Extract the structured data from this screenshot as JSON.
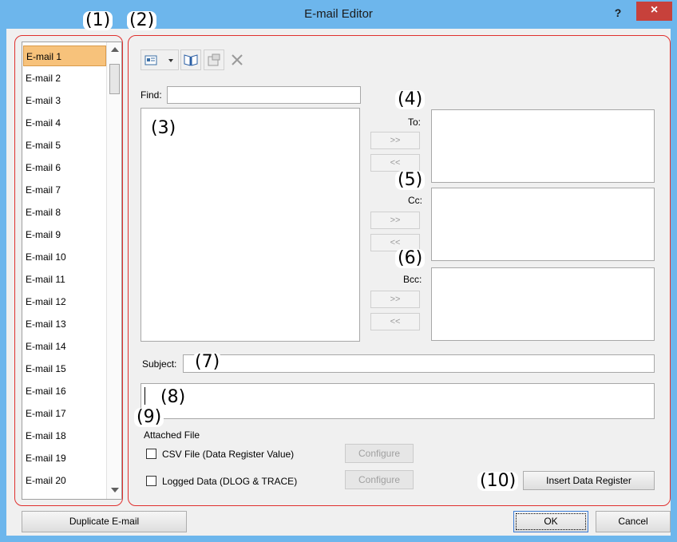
{
  "window": {
    "title": "E-mail Editor",
    "help_label": "?",
    "close_label": "×"
  },
  "email_list": {
    "items": [
      "E-mail 1",
      "E-mail 2",
      "E-mail 3",
      "E-mail 4",
      "E-mail 5",
      "E-mail 6",
      "E-mail 7",
      "E-mail 8",
      "E-mail 9",
      "E-mail 10",
      "E-mail 11",
      "E-mail 12",
      "E-mail 13",
      "E-mail 14",
      "E-mail 15",
      "E-mail 16",
      "E-mail 17",
      "E-mail 18",
      "E-mail 19",
      "E-mail 20"
    ],
    "selected": "E-mail 1"
  },
  "annotations": [
    "(1)",
    "(2)",
    "(3)",
    "(4)",
    "(5)",
    "(6)",
    "(7)",
    "(8)",
    "(9)",
    "(10)"
  ],
  "toolbar": {
    "icons": [
      "address-book-view-icon",
      "dropdown-arrow-icon",
      "book-icon",
      "properties-icon",
      "delete-x-icon"
    ]
  },
  "find": {
    "label": "Find:",
    "value": ""
  },
  "recipients": {
    "to_label": "To:",
    "cc_label": "Cc:",
    "bcc_label": "Bcc:",
    "add_label": ">>",
    "remove_label": "<<"
  },
  "subject": {
    "label": "Subject:",
    "value": ""
  },
  "body": {
    "value": ""
  },
  "attached": {
    "title": "Attached File",
    "csv_label": "CSV File (Data Register Value)",
    "logged_label": "Logged Data (DLOG & TRACE)",
    "csv_checked": false,
    "logged_checked": false,
    "configure_label": "Configure"
  },
  "buttons": {
    "insert_data_register": "Insert Data Register",
    "duplicate": "Duplicate E-mail",
    "ok": "OK",
    "cancel": "Cancel"
  },
  "colors": {
    "accent": "#6db6ec",
    "selected_item": "#f7c27b",
    "annotation_border": "#e0302e",
    "close": "#c7413b"
  }
}
